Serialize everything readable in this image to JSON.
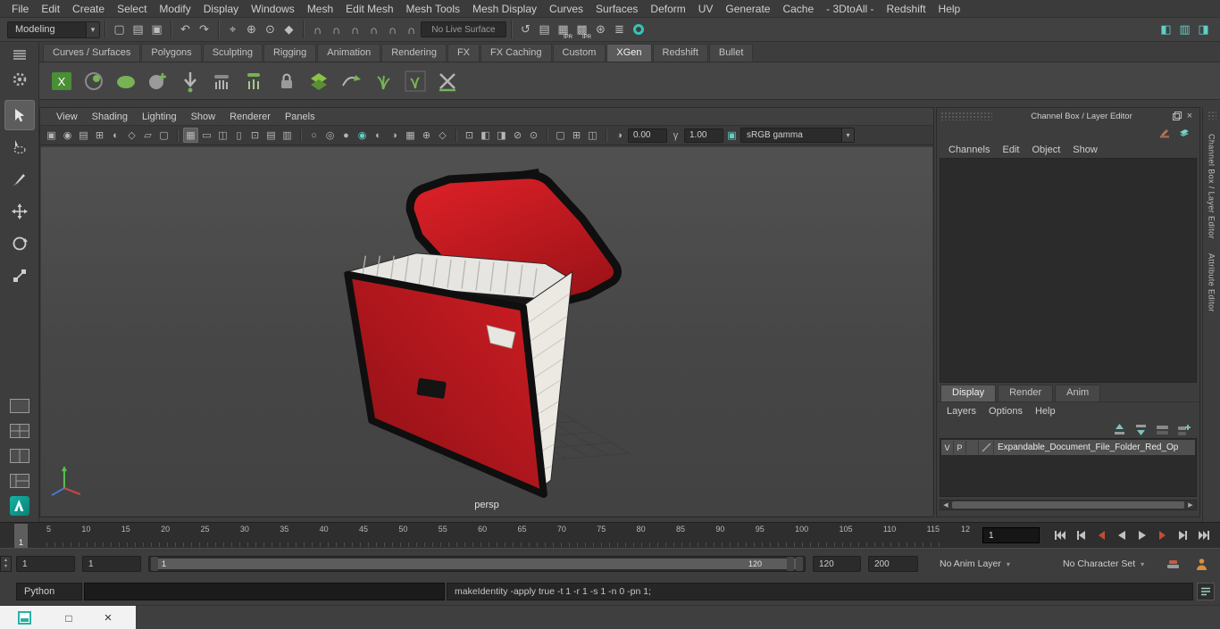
{
  "icons": {
    "close": "×",
    "maximize": "□",
    "dropdown": "▾",
    "spinner_up": "▴",
    "spinner_down": "▾",
    "scroll_left": "◀",
    "scroll_right": "▶"
  },
  "colors": {
    "accent_teal": "#35c4b5",
    "shelf_green": "#77b254",
    "folder_red": "#c8181f",
    "key_red": "#c44b35"
  },
  "menubar": {
    "items": [
      "File",
      "Edit",
      "Create",
      "Select",
      "Modify",
      "Display",
      "Windows",
      "Mesh",
      "Edit Mesh",
      "Mesh Tools",
      "Mesh Display",
      "Curves",
      "Surfaces",
      "Deform",
      "UV",
      "Generate",
      "Cache",
      "- 3DtoAll -",
      "Redshift",
      "Help"
    ]
  },
  "toolbar": {
    "mode": "Modeling",
    "live_surface": "No Live Surface",
    "ipr_label": "IPR"
  },
  "shelf": {
    "tabs": [
      "Curves / Surfaces",
      "Polygons",
      "Sculpting",
      "Rigging",
      "Animation",
      "Rendering",
      "FX",
      "FX Caching",
      "Custom",
      "XGen",
      "Redshift",
      "Bullet"
    ],
    "active_index": 9
  },
  "viewport": {
    "menus": [
      "View",
      "Shading",
      "Lighting",
      "Show",
      "Renderer",
      "Panels"
    ],
    "exposure": "0.00",
    "gamma": "1.00",
    "colorspace": "sRGB gamma",
    "camera_label": "persp"
  },
  "channel_box": {
    "title": "Channel Box / Layer Editor",
    "menus": [
      "Channels",
      "Edit",
      "Object",
      "Show"
    ],
    "tabs": [
      "Display",
      "Render",
      "Anim"
    ],
    "active_tab_index": 0,
    "layer_menus": [
      "Layers",
      "Options",
      "Help"
    ],
    "layer_row": {
      "visibility": "V",
      "playback": "P",
      "name": "Expandable_Document_File_Folder_Red_Op"
    }
  },
  "side_tabs": [
    "Channel Box / Layer Editor",
    "Attribute Editor"
  ],
  "timeline": {
    "ticks": [
      "5",
      "10",
      "15",
      "20",
      "25",
      "30",
      "35",
      "40",
      "45",
      "50",
      "55",
      "60",
      "65",
      "70",
      "75",
      "80",
      "85",
      "90",
      "95",
      "100",
      "105",
      "110",
      "115"
    ],
    "end_tick": "12",
    "current_frame": "1",
    "frame_field": "1"
  },
  "range_bar": {
    "playback_start": "1",
    "anim_start": "1",
    "handle_start": "1",
    "handle_end": "120",
    "playback_end": "120",
    "anim_end": "200",
    "anim_layer": "No Anim Layer",
    "character_set": "No Character Set"
  },
  "command_line": {
    "mode": "Python",
    "result": "makeIdentity -apply true -t 1 -r 1 -s 1 -n 0 -pn 1;"
  },
  "window": {
    "maximize": "□",
    "close": "×"
  }
}
